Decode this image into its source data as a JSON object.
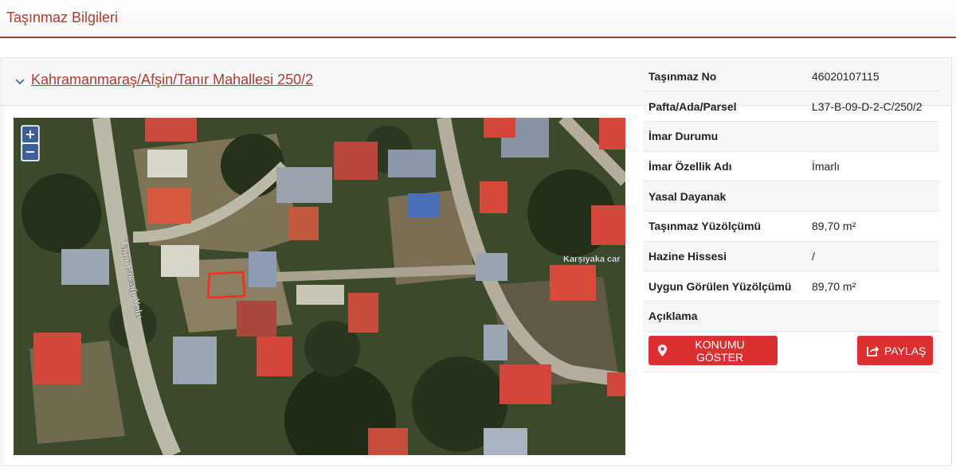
{
  "header": {
    "title": "Taşınmaz Bilgileri"
  },
  "card": {
    "address": "Kahramanmaraş/Afşin/Tanır Mahallesi 250/2"
  },
  "map": {
    "zoom_in": "+",
    "zoom_out": "−",
    "labels": {
      "road": "Tanır Bucağı Yolu",
      "street": "Karşıyaka car"
    }
  },
  "details": {
    "rows": [
      {
        "label": "Taşınmaz No",
        "value": "46020107115"
      },
      {
        "label": "Pafta/Ada/Parsel",
        "value": "L37-B-09-D-2-C/250/2"
      },
      {
        "label": "İmar Durumu",
        "value": ""
      },
      {
        "label": "İmar Özellik Adı",
        "value": "İmarlı"
      },
      {
        "label": "Yasal Dayanak",
        "value": ""
      },
      {
        "label": "Taşınmaz Yüzölçümü",
        "value": "89,70 m²"
      },
      {
        "label": "Hazine Hissesi",
        "value": "/"
      },
      {
        "label": "Uygun Görülen Yüzölçümü",
        "value": "89,70 m²"
      },
      {
        "label": "Açıklama",
        "value": ""
      }
    ]
  },
  "actions": {
    "show_location": "KONUMU GÖSTER",
    "share": "PAYLAŞ"
  },
  "colors": {
    "accent": "#b03a2e",
    "button": "#dc2f2f",
    "link_underline": "#3366cc"
  }
}
